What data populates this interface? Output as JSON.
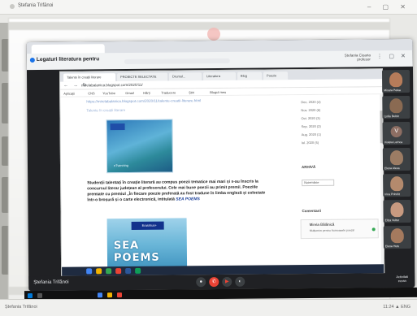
{
  "outer": {
    "title": "Ștefania Trifănoi",
    "taskbar_label": "Ștefania Trifănoi",
    "tray": "11:24  ▲  ENG"
  },
  "meet": {
    "title": "Legaturi literatura pentru",
    "user_name": "Ștefania Cioaria",
    "user_sub": "profesor",
    "bottom_label": "Ștefania Trifănoi",
    "right_label_1": "Activitati",
    "right_label_2": "ecran",
    "participants": [
      {
        "name": "Mioara Pelea",
        "color": "#b67c5a"
      },
      {
        "name": "Lydia Belcin",
        "color": "#8a6a52"
      },
      {
        "name": "Violeta Lerhca",
        "initial": "V"
      },
      {
        "name": "Elena Alexa",
        "color": "#9c7c64"
      },
      {
        "name": "Irina Pohrilit",
        "color": "#b48a6d"
      },
      {
        "name": "Eliza Vultur",
        "color": "#c89a80"
      },
      {
        "name": "Elena Hutu",
        "color": "#a57a5e"
      }
    ]
  },
  "browser": {
    "tabs": [
      "Talente în creații literare",
      "PROIECTE SELECTATE",
      "Drumul...",
      "Literatura",
      "Blog",
      "Poezie"
    ],
    "url": "mirelabalanica.blogspot.com/2020/11/",
    "bookmarks": [
      "Aplicații",
      "CNS",
      "YouTube",
      "Gmail",
      "Hărți",
      "Traducere",
      "Știri",
      "Blogul meu"
    ],
    "link_line": "https://mirelabalanica.blogspot.com/2020/11/talente-creatii-literare.html",
    "sub_line": "Talente în creații literare",
    "card_caption": "eTwinning",
    "paragraph": "Studenții talentați în creație literară au compus poezii tematice mai mari și s-au înscris la concursul literar județean al profesorului. Cele mai bune poezii au primit premii. Poeziile premiate cu premiul „În fiecare poezie preferată au fost traduse în limba engleză și colectate într-o broșură și o carte electronică, intitulată",
    "paragraph_link": "SEA POEMS",
    "poster_title": "SEA POEMS",
    "poster_badge": "Erasmus+",
    "sidebar": {
      "items": [
        "Dec. 2020 (4)",
        "Nov. 2020 (6)",
        "Oct. 2020 (3)",
        "Sep. 2020 (2)",
        "Aug. 2020 (1)",
        "Iul. 2020 (5)"
      ],
      "head_label": "ARHIVĂ",
      "select": "Noiembrie",
      "comments_head": "Comentarii",
      "comment_name": "Mirela Bălănică",
      "comment_text": "Mulțumim pentru frumoasele poezii!"
    }
  }
}
